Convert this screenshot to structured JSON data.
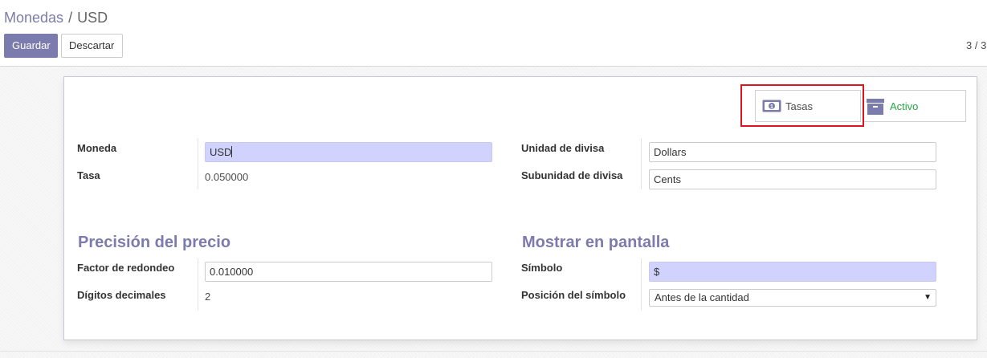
{
  "breadcrumb": {
    "parent": "Monedas",
    "separator": "/",
    "current": "USD"
  },
  "toolbar": {
    "save_label": "Guardar",
    "discard_label": "Descartar"
  },
  "pager": {
    "text": "3 / 3"
  },
  "smart_buttons": {
    "rates": {
      "label": "Tasas",
      "icon": "money-icon"
    },
    "active": {
      "label": "Activo",
      "icon": "archive-icon",
      "color": "#28a745"
    }
  },
  "fields": {
    "currency": {
      "label": "Moneda",
      "value": "USD"
    },
    "rate": {
      "label": "Tasa",
      "value": "0.050000"
    },
    "currency_unit": {
      "label": "Unidad de divisa",
      "value": "Dollars"
    },
    "currency_subunit": {
      "label": "Subunidad de divisa",
      "value": "Cents"
    }
  },
  "price_precision": {
    "title": "Precisión del precio",
    "rounding": {
      "label": "Factor de redondeo",
      "value": "0.010000"
    },
    "decimal_places": {
      "label": "Dígitos decimales",
      "value": "2"
    }
  },
  "display": {
    "title": "Mostrar en pantalla",
    "symbol": {
      "label": "Símbolo",
      "value": "$"
    },
    "symbol_position": {
      "label": "Posición del símbolo",
      "value": "Antes de la cantidad"
    }
  },
  "colors": {
    "brand": "#7c7bad",
    "required_bg": "#d2d2ff",
    "highlight": "#e0131f"
  }
}
